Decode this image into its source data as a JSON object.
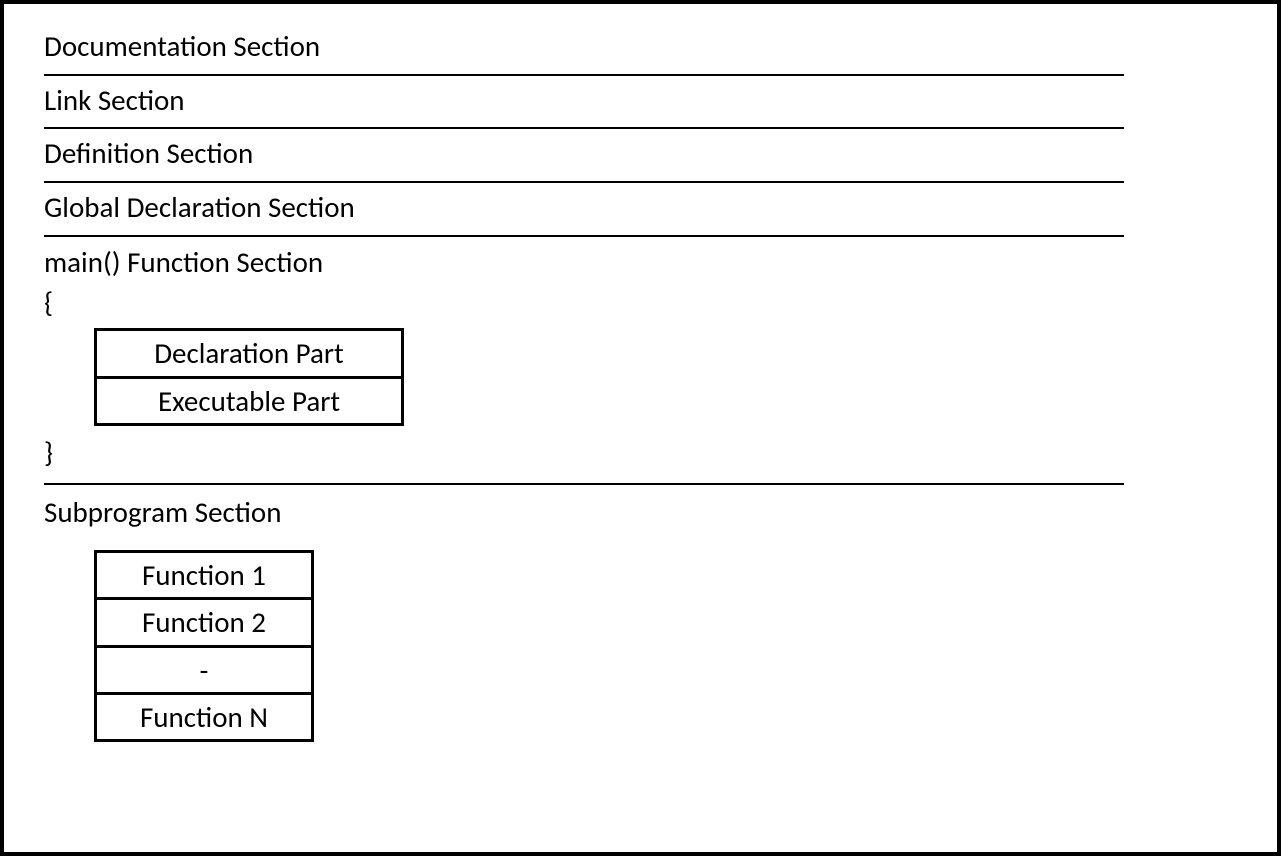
{
  "sections": {
    "documentation": "Documentation Section",
    "link": "Link Section",
    "definition": "Definition Section",
    "global_declaration": "Global Declaration Section"
  },
  "main_section": {
    "heading": "main() Function Section",
    "open_brace": "{",
    "close_brace": "}",
    "parts": {
      "declaration": "Declaration Part",
      "executable": "Executable Part"
    }
  },
  "subprogram_section": {
    "heading": "Subprogram Section",
    "functions": {
      "f1": "Function 1",
      "f2": "Function 2",
      "ellipsis": "-",
      "fn": "Function N"
    }
  }
}
